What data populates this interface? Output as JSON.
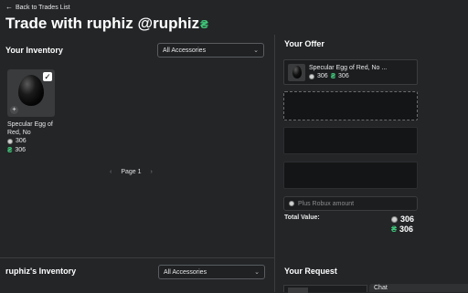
{
  "header": {
    "back_label": "Back to Trades List",
    "title": "Trade with ruphiz @ruphiz",
    "title_icon": "rap-icon"
  },
  "your_inventory": {
    "heading": "Your Inventory",
    "filter": {
      "selected": "All Accessories"
    },
    "items": [
      {
        "name": "Specular Egg of Red, No",
        "robux_value": "306",
        "rap_value": "306",
        "selected": true
      }
    ],
    "pagination": {
      "label": "Page 1"
    }
  },
  "partner_inventory": {
    "heading": "ruphiz's Inventory",
    "filter": {
      "selected": "All Accessories"
    }
  },
  "your_offer": {
    "heading": "Your Offer",
    "slots": [
      {
        "name": "Specular Egg of Red, No ...",
        "robux_value": "306",
        "rap_value": "306"
      }
    ],
    "robux_placeholder": "Plus Robux amount",
    "total_label": "Total Value:",
    "total_robux": "306",
    "total_rap": "306"
  },
  "your_request": {
    "heading": "Your Request"
  },
  "chat": {
    "label": "Chat"
  },
  "colors": {
    "background": "#232527",
    "rap_green": "#3fc679",
    "text": "#ffffff"
  }
}
